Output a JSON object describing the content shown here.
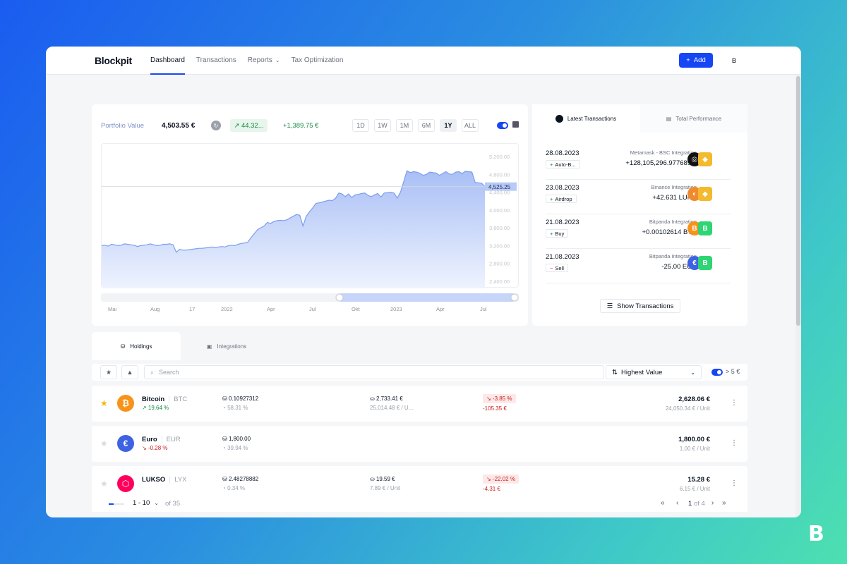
{
  "brand": {
    "logo": "Blockpit",
    "corner_mark": "B"
  },
  "nav": {
    "items": [
      {
        "label": "Dashboard",
        "active": true
      },
      {
        "label": "Transactions",
        "active": false
      },
      {
        "label": "Reports",
        "active": false
      },
      {
        "label": "Tax Optimization",
        "active": false
      }
    ],
    "add_label": "Add",
    "avatar": "B"
  },
  "portfolio": {
    "label": "Portfolio Value",
    "value": "4,503.55 €",
    "pct": "↗ 44.32...",
    "abs": "+1,389.75 €",
    "ranges": [
      "1D",
      "1W",
      "1M",
      "6M",
      "1Y",
      "ALL"
    ],
    "active_range": "1Y",
    "current_badge": "4,525.25",
    "chart_data": {
      "type": "area",
      "y_ticks": [
        "5,200.00",
        "4,800.00",
        "4,400.00",
        "4,000.00",
        "3,600.00",
        "3,200.00",
        "2,800.00",
        "2,400.00"
      ],
      "ylim": [
        2400,
        5200
      ],
      "x_labels": [
        "Mai",
        "Aug",
        "17",
        "2022",
        "Apr",
        "Jul",
        "Okt",
        "2023",
        "Apr",
        "Jul"
      ],
      "values": [
        3200,
        3210,
        3190,
        3230,
        3220,
        3200,
        3210,
        3240,
        3230,
        3220,
        3210,
        3180,
        3200,
        3210,
        3220,
        3240,
        3220,
        3200,
        3210,
        3230,
        3230,
        3240,
        3220,
        3050,
        3120,
        3100,
        3100,
        3110,
        3120,
        3130,
        3140,
        3140,
        3150,
        3160,
        3170,
        3160,
        3170,
        3180,
        3170,
        3200,
        3210,
        3200,
        3230,
        3250,
        3260,
        3280,
        3380,
        3470,
        3560,
        3600,
        3640,
        3720,
        3700,
        3740,
        3760,
        3770,
        3760,
        3780,
        3820,
        3860,
        3900,
        3880,
        3640,
        3860,
        3960,
        4050,
        4150,
        4160,
        4180,
        4200,
        4220,
        4210,
        4260,
        4380,
        4360,
        4300,
        4360,
        4280,
        4340,
        4350,
        4370,
        4380,
        4330,
        4300,
        4340,
        4370,
        4290,
        4380,
        4390,
        4400,
        4380,
        4270,
        4400,
        4640,
        4880,
        4840,
        4860,
        4850,
        4820,
        4780,
        4800,
        4850,
        4840,
        4830,
        4780,
        4820,
        4860,
        4810,
        4800,
        4850,
        4860,
        4820,
        4870,
        4860,
        4850,
        4620,
        4610,
        4600,
        4525
      ]
    }
  },
  "latest": {
    "tab_active": "Latest Transactions",
    "tab_other": "Total Performance",
    "items": [
      {
        "date": "28.08.2023",
        "type": "Auto-B...",
        "sign": "+",
        "source": "Metamask - BSC Integration",
        "amount": "+128,105,296.977689...",
        "c1": "#111111",
        "c1g": "◎",
        "c2": "#f3ba2f",
        "c2g": "◆"
      },
      {
        "date": "23.08.2023",
        "type": "Airdrop",
        "sign": "+",
        "source": "Binance Integration",
        "amount": "+42.631 LUNA",
        "c1": "#f08a2e",
        "c1g": "◐",
        "c2": "#f3ba2f",
        "c2g": "◆"
      },
      {
        "date": "21.08.2023",
        "type": "Buy",
        "sign": "+",
        "source": "Bitpanda Integration",
        "amount": "+0.00102614 BTC",
        "c1": "#f7931a",
        "c1g": "B",
        "c2": "#2ed573",
        "c2g": "B"
      },
      {
        "date": "21.08.2023",
        "type": "Sell",
        "sign": "−",
        "source": "Bitpanda Integration",
        "amount": "-25.00 EUR",
        "c1": "#3d63e3",
        "c1g": "€",
        "c2": "#2ed573",
        "c2g": "B"
      }
    ],
    "show_label": "Show Transactions"
  },
  "holdings": {
    "tab_active": "Holdings",
    "tab_other": "Integrations",
    "search_placeholder": "Search",
    "sort_label": "Highest Value",
    "threshold": "> 5 €",
    "rows": [
      {
        "starred": true,
        "name": "Bitcoin",
        "sym": "BTC",
        "chg": "↗ 19.64 %",
        "chg_pos": true,
        "icon_color": "#f7931a",
        "icon_glyph": "₿",
        "qty": "0.10927312",
        "share": "58.31 %",
        "cost": "2,733.41 €",
        "cost_unit": "25,014.48 € / U...",
        "pl_pct": "↘ -3.85 %",
        "pl_abs": "-105.35 €",
        "value": "2,628.06 €",
        "unit": "24,050.34 € / Unit"
      },
      {
        "starred": false,
        "name": "Euro",
        "sym": "EUR",
        "chg": "↘ -0.28 %",
        "chg_pos": false,
        "icon_color": "#3d63e3",
        "icon_glyph": "€",
        "qty": "1,800.00",
        "share": "39.94 %",
        "cost": "",
        "cost_unit": "",
        "pl_pct": "",
        "pl_abs": "",
        "value": "1,800.00 €",
        "unit": "1.00 € / Unit"
      },
      {
        "starred": false,
        "name": "LUKSO",
        "sym": "LYX",
        "chg": "",
        "chg_pos": true,
        "icon_color": "#fe005b",
        "icon_glyph": "⬡",
        "qty": "2.48278882",
        "share": "0.34 %",
        "cost": "19.59 €",
        "cost_unit": "7.89 € / Unit",
        "pl_pct": "↘ -22.02 %",
        "pl_abs": "-4.31 €",
        "value": "15.28 €",
        "unit": "6.15 € / Unit"
      }
    ],
    "pager": {
      "range": "1 - 10",
      "of": "of 35",
      "page": "1",
      "page_of": "of 4"
    }
  }
}
